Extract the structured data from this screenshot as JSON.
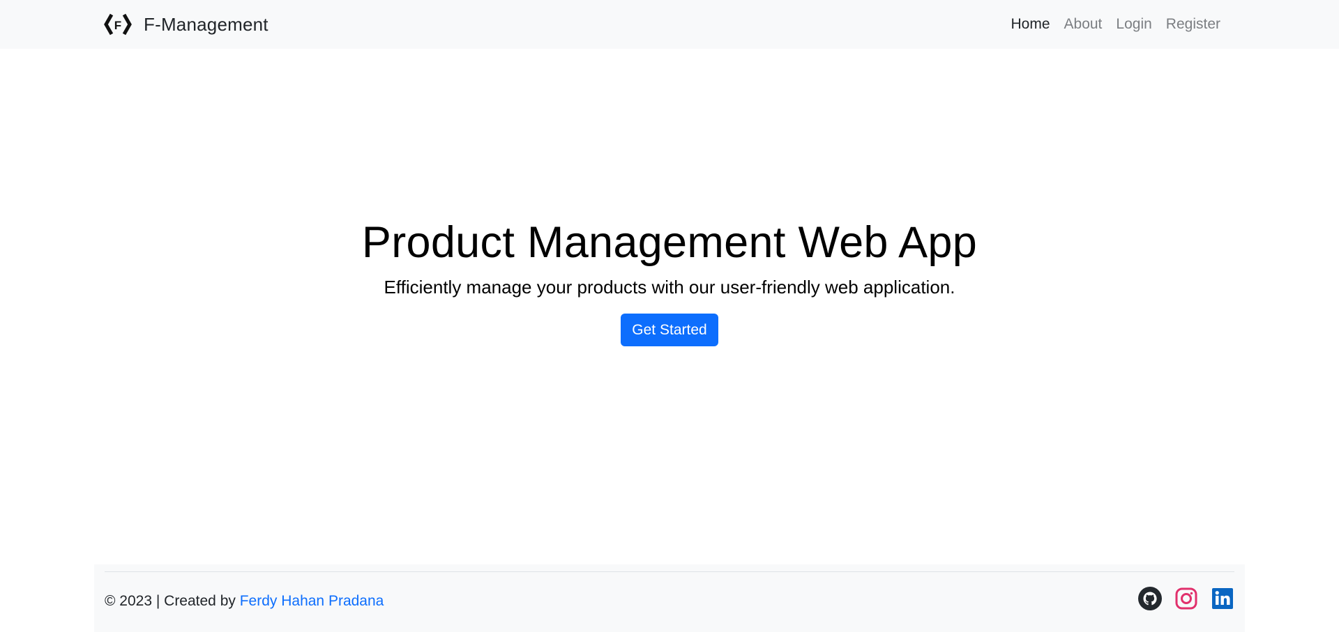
{
  "navbar": {
    "brand_name": "F-Management",
    "links": [
      {
        "label": "Home",
        "active": true
      },
      {
        "label": "About",
        "active": false
      },
      {
        "label": "Login",
        "active": false
      },
      {
        "label": "Register",
        "active": false
      }
    ]
  },
  "hero": {
    "title": "Product Management Web App",
    "subtitle": "Efficiently manage your products with our user-friendly web application.",
    "cta_label": "Get Started"
  },
  "footer": {
    "copyright": "© 2023 | Created by ",
    "author": "Ferdy Hahan Pradana",
    "social": [
      {
        "icon": "github-icon",
        "color": "#24292e"
      },
      {
        "icon": "instagram-icon",
        "color": "#e1306c"
      },
      {
        "icon": "linkedin-icon",
        "color": "#0a66c2"
      }
    ]
  },
  "colors": {
    "primary": "#0d6efd",
    "navbar_bg": "#f8f9fa",
    "nav_muted": "#7b7e82"
  }
}
